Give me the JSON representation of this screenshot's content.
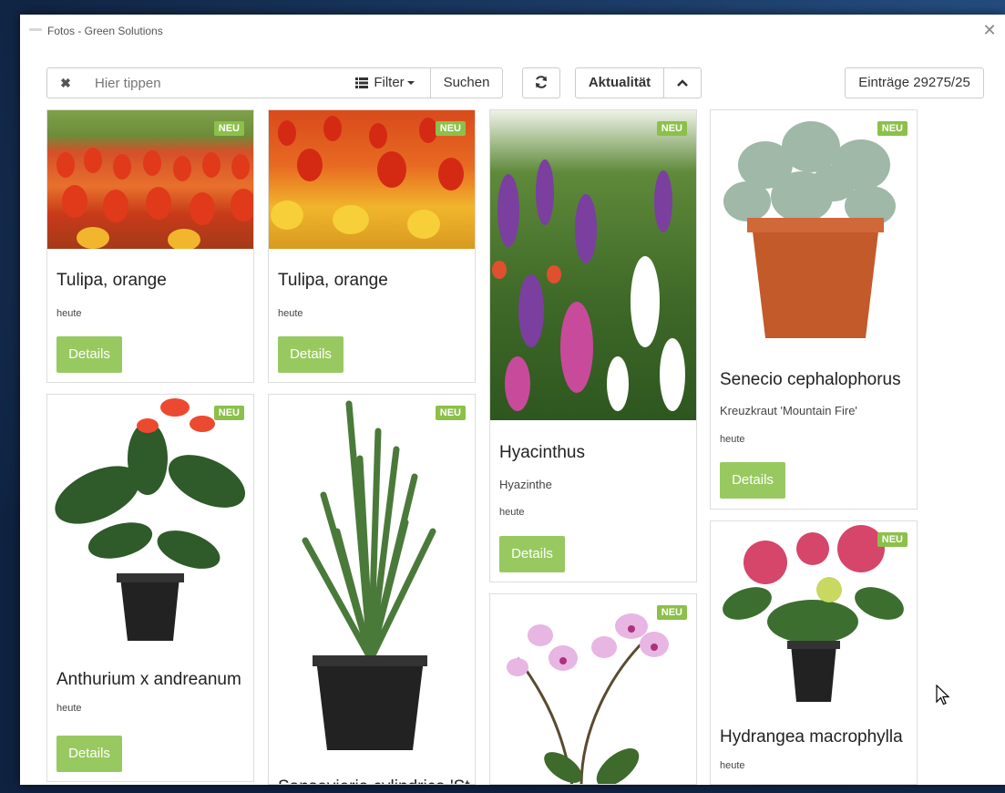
{
  "window": {
    "title": "Fotos - Green Solutions"
  },
  "toolbar": {
    "search_placeholder": "Hier tippen",
    "filter_label": "Filter",
    "search_button": "Suchen",
    "sort_label": "Aktualität",
    "count_label": "Einträge 29275/25"
  },
  "badge_text": "NEU",
  "details_label": "Details",
  "cards": [
    {
      "title": "Tulipa, orange",
      "date": "heute"
    },
    {
      "title": "Tulipa, orange",
      "date": "heute"
    },
    {
      "title": "Hyacinthus",
      "subtitle": "Hyazinthe",
      "date": "heute"
    },
    {
      "title": "Senecio cephalophorus",
      "subtitle": "Kreuzkraut 'Mountain Fire'",
      "date": "heute"
    },
    {
      "title": "Anthurium x andreanum",
      "date": "heute"
    },
    {
      "title": "Sansevieria cylindrica 'St"
    },
    {
      "title": ""
    },
    {
      "title": "Hydrangea macrophylla",
      "date": "heute"
    }
  ],
  "colors": {
    "accent": "#98c960",
    "badge": "#8cc04a"
  }
}
